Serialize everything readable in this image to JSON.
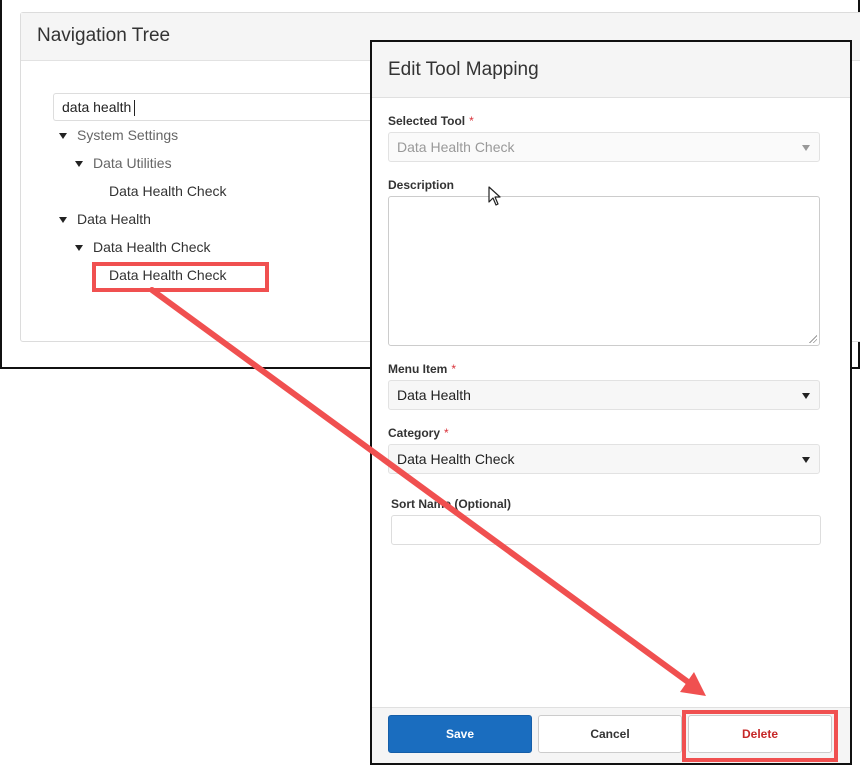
{
  "nav_tree": {
    "title": "Navigation Tree",
    "search_value": "data health",
    "items": [
      {
        "label": "System Settings",
        "level": 0,
        "expanded": true
      },
      {
        "label": "Data Utilities",
        "level": 1,
        "expanded": true
      },
      {
        "label": "Data Health Check",
        "level": 2
      },
      {
        "label": "Data Health",
        "level": 0,
        "expanded": true
      },
      {
        "label": "Data Health Check",
        "level": 1,
        "expanded": true
      },
      {
        "label": "Data Health Check",
        "level": 2,
        "highlighted": true
      }
    ]
  },
  "modal": {
    "title": "Edit Tool Mapping",
    "selected_tool": {
      "label": "Selected Tool",
      "required_mark": "*",
      "value": "Data Health Check",
      "disabled": true
    },
    "description": {
      "label": "Description",
      "value": ""
    },
    "menu_item": {
      "label": "Menu Item",
      "required_mark": "*",
      "value": "Data Health"
    },
    "category": {
      "label": "Category",
      "required_mark": "*",
      "value": "Data Health Check"
    },
    "sort_name": {
      "label": "Sort Name (Optional)",
      "value": ""
    },
    "buttons": {
      "save": "Save",
      "cancel": "Cancel",
      "delete": "Delete"
    }
  },
  "colors": {
    "primary": "#1a6dbf",
    "delete_text": "#c62828",
    "required": "#d9323a",
    "annotation": "#f05050"
  }
}
